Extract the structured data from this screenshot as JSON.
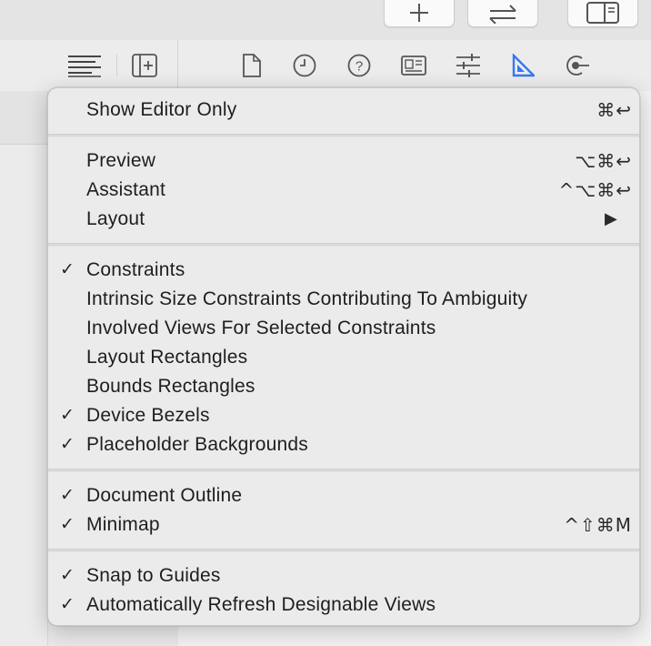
{
  "window": {
    "accent": "#3478f6"
  },
  "menu": {
    "items": [
      {
        "label": "Show Editor Only",
        "shortcut": "⌘↩",
        "checked": false
      },
      {
        "label": "Preview",
        "shortcut": "⌥⌘↩",
        "checked": false
      },
      {
        "label": "Assistant",
        "shortcut": "^⌥⌘↩",
        "checked": false
      },
      {
        "label": "Layout",
        "submenu_arrow": "▶",
        "checked": false
      },
      {
        "label": "Constraints",
        "checked": true,
        "check": "✓"
      },
      {
        "label": "Intrinsic Size Constraints Contributing To Ambiguity",
        "checked": false
      },
      {
        "label": "Involved Views For Selected Constraints",
        "checked": false
      },
      {
        "label": "Layout Rectangles",
        "checked": false
      },
      {
        "label": "Bounds Rectangles",
        "checked": false
      },
      {
        "label": "Device Bezels",
        "checked": true,
        "check": "✓"
      },
      {
        "label": "Placeholder Backgrounds",
        "checked": true,
        "check": "✓"
      },
      {
        "label": "Document Outline",
        "checked": true,
        "check": "✓"
      },
      {
        "label": "Minimap",
        "shortcut": "^⇧⌘M",
        "checked": true,
        "check": "✓"
      },
      {
        "label": "Snap to Guides",
        "checked": true,
        "check": "✓"
      },
      {
        "label": "Automatically Refresh Designable Views",
        "checked": true,
        "check": "✓"
      }
    ]
  },
  "toolbar_icons": [
    "add-icon",
    "swap-arrows-icon",
    "inspector-panel-icon",
    "editor-options-icon",
    "add-editor-icon",
    "file-inspector-icon",
    "history-inspector-icon",
    "help-inspector-icon",
    "identity-inspector-icon",
    "attributes-inspector-icon",
    "size-inspector-icon",
    "connections-inspector-icon"
  ]
}
